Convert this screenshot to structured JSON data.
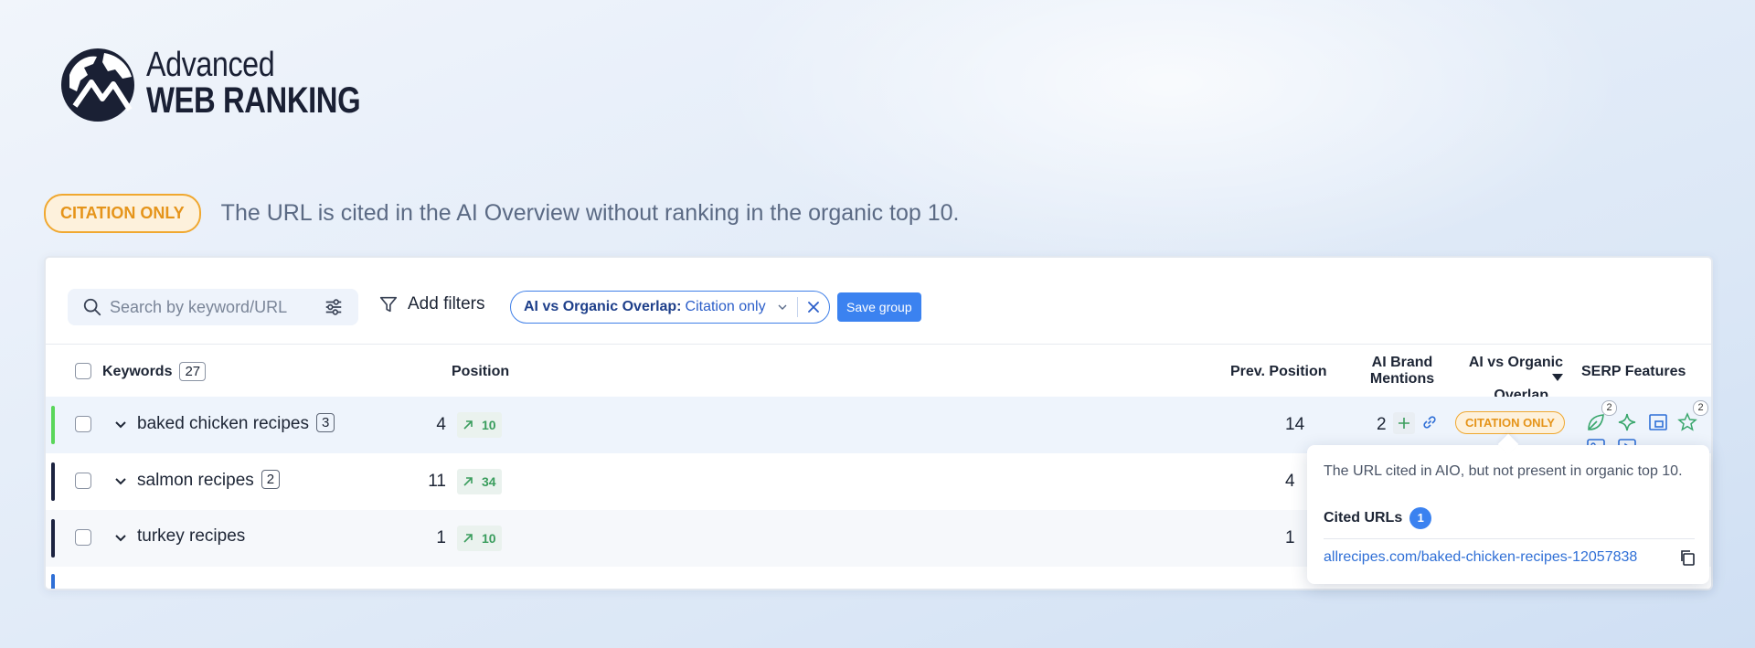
{
  "logo": {
    "line1": "Advanced",
    "line2": "WEB RANKING"
  },
  "legend": {
    "badge": "CITATION ONLY",
    "description": "The URL is cited in the AI Overview without ranking in the organic top 10."
  },
  "toolbar": {
    "search_placeholder": "Search by keyword/URL",
    "add_filters": "Add filters",
    "filter_chip_label": "AI vs Organic Overlap:",
    "filter_chip_value": "Citation only",
    "save_group": "Save group"
  },
  "table": {
    "headers": {
      "keywords": "Keywords",
      "keywords_count": "27",
      "position": "Position",
      "prev_position": "Prev. Position",
      "ai_brand_mentions_1": "AI Brand",
      "ai_brand_mentions_2": "Mentions",
      "overlap_1": "AI vs Organic",
      "overlap_2": "Overlap",
      "serp_features": "SERP Features"
    },
    "rows": [
      {
        "keyword": "baked chicken recipes",
        "count": "3",
        "position": "4",
        "change": "10",
        "prev": "14",
        "mentions": "2",
        "overlap": "CITATION ONLY",
        "serp_counts": [
          "2",
          "2"
        ],
        "bar_color": "#5ad65a"
      },
      {
        "keyword": "salmon recipes",
        "count": "2",
        "position": "11",
        "change": "34",
        "prev": "4",
        "bar_color": "#1c2340"
      },
      {
        "keyword": "turkey recipes",
        "count": "",
        "position": "1",
        "change": "10",
        "prev": "1",
        "bar_color": "#1c2340"
      }
    ]
  },
  "popover": {
    "description": "The URL cited in AIO, but not present in organic top 10.",
    "cited_label": "Cited URLs",
    "cited_count": "1",
    "url": "allrecipes.com/baked-chicken-recipes-12057838"
  },
  "colors": {
    "accent": "#3b82f0",
    "citation": "#f0a830",
    "positive": "#3a9d5d"
  }
}
